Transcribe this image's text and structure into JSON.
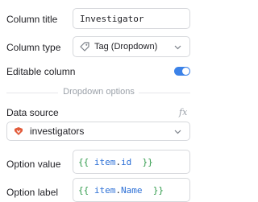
{
  "column_title": {
    "label": "Column title",
    "value": "Investigator"
  },
  "column_type": {
    "label": "Column type",
    "value": "Tag (Dropdown)",
    "icon": "tag-icon"
  },
  "editable_column": {
    "label": "Editable column",
    "enabled": true
  },
  "section": {
    "title": "Dropdown options"
  },
  "data_source": {
    "label": "Data source",
    "fx": "fx",
    "value": "investigators",
    "icon": "data-source-icon"
  },
  "option_value": {
    "label": "Option value",
    "open": "{{",
    "obj": "item",
    "dot": ".",
    "prop": "id",
    "close": "}}"
  },
  "option_label": {
    "label": "Option label",
    "open": "{{",
    "obj": "item",
    "dot": ".",
    "prop": "Name",
    "close": "}}"
  },
  "colors": {
    "accent": "#3c82e8",
    "code_brace": "#2f9a4a",
    "code_ident": "#2b6fd6"
  }
}
